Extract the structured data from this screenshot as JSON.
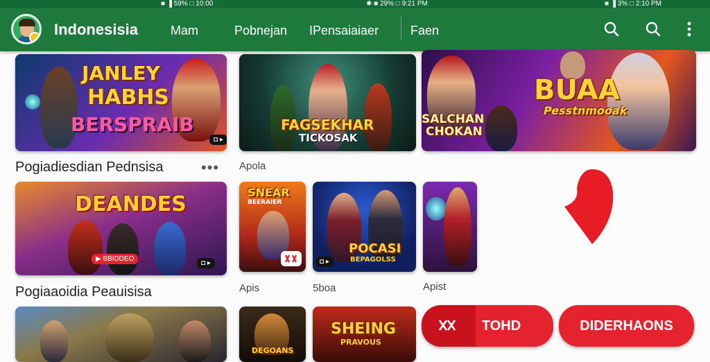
{
  "statusbar": {
    "left": "■ ▐ 59% □ 10:00",
    "middle": "✹ ■ 29% □ 9:21 PM",
    "right": "■ ▐ 3% □ 2:10 PM"
  },
  "header": {
    "title": "Indonesisia",
    "tabs": [
      "Mam",
      "Pobnejan",
      "IPensaiaiaer",
      "Faen"
    ]
  },
  "sections": [
    {
      "title": "Pogiadiesdian Pednsisa",
      "more": "•••"
    },
    {
      "title": "Pogiaaoidia Peauisisa"
    }
  ],
  "captions": {
    "row1_second": "Apola",
    "row2_a": "Apis",
    "row2_b": "5boa",
    "row2_c": "Apist"
  },
  "cards": {
    "c1": {
      "line1": "JANLEY",
      "line2": "HABHS",
      "line3": "BERSPRAIB",
      "chip": "◘ ▸"
    },
    "c2": {
      "line1": "FAGSEKHAR",
      "line2": "TICKOSAK"
    },
    "c3": {
      "line1": "SALCHAN",
      "line2": "CHOKAN",
      "line3": "BUAA",
      "line4": "Pesstnmooak"
    },
    "c4": {
      "line1": "DEANDES",
      "chip_left": "▶ BBIDDEO",
      "chip_right": "◘ ▸"
    },
    "c5": {
      "line1": "SNEAR",
      "line2": "BEERAIER"
    },
    "c6": {
      "line1": "POCASI",
      "line2": "BEPAGOLSS",
      "chip": "◘ ▸"
    },
    "c8": {
      "line1": "DEGOANS"
    },
    "c9": {
      "line1": "SHEING",
      "line2": "PRAVOUS"
    }
  },
  "actions": {
    "small_label": "TOHD",
    "large_label": "DIDERHAONS"
  },
  "colors": {
    "header": "#1d7a3c",
    "status": "#146b36",
    "accent_red": "#e5232f"
  },
  "icons": [
    "search-icon",
    "search-icon",
    "more-vert-icon",
    "map-pin-icon",
    "shuffle-icon"
  ]
}
